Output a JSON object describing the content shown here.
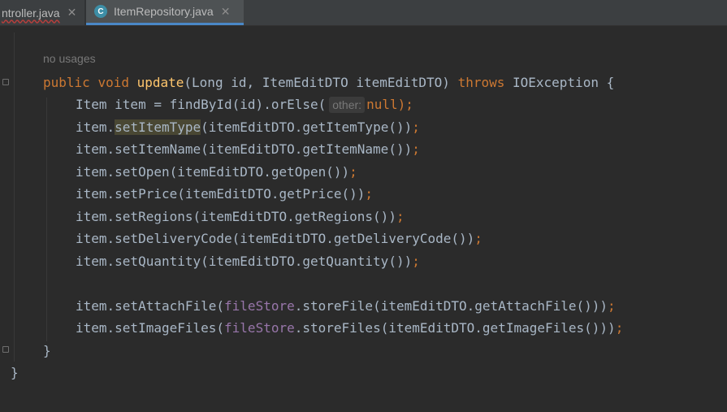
{
  "tabs": [
    {
      "label": "ntroller.java",
      "active": false,
      "has_error": true
    },
    {
      "label": "ItemRepository.java",
      "active": true,
      "icon": "class-icon",
      "icon_letter": "C"
    }
  ],
  "close_glyph": "✕",
  "usages_hint": "no usages",
  "param_hint": "other:",
  "code": {
    "line1": {
      "kw1": "public",
      "kw2": "void",
      "name": "update",
      "p1": "(Long id, ItemEditDTO itemEditDTO) ",
      "kw3": "throws",
      "p2": " IOException {"
    },
    "line2": {
      "a": "Item item = findById(id).orElse(",
      "null": "null",
      "b": ");"
    },
    "line3": {
      "a": "item.",
      "hl": "setItemType",
      "b": "(itemEditDTO.getItemType())",
      "semi": ";"
    },
    "line4": {
      "a": "item.setItemName(itemEditDTO.getItemName())",
      "semi": ";"
    },
    "line5": {
      "a": "item.setOpen(itemEditDTO.getOpen())",
      "semi": ";"
    },
    "line6": {
      "a": "item.setPrice(itemEditDTO.getPrice())",
      "semi": ";"
    },
    "line7": {
      "a": "item.setRegions(itemEditDTO.getRegions())",
      "semi": ";"
    },
    "line8": {
      "a": "item.setDeliveryCode(itemEditDTO.getDeliveryCode())",
      "semi": ";"
    },
    "line9": {
      "a": "item.setQuantity(itemEditDTO.getQuantity())",
      "semi": ";"
    },
    "line10": {
      "a": "item.setAttachFile(",
      "fld": "fileStore",
      "b": ".storeFile(itemEditDTO.getAttachFile()))",
      "semi": ";"
    },
    "line11": {
      "a": "item.setImageFiles(",
      "fld": "fileStore",
      "b": ".storeFiles(itemEditDTO.getImageFiles()))",
      "semi": ";"
    },
    "line12": "}",
    "line13": "}"
  },
  "colors": {
    "background": "#2b2b2b",
    "keyword": "#cc7832",
    "method_decl": "#ffc66d",
    "field": "#9876aa",
    "text": "#a9b7c6",
    "tab_accent": "#4a88c7"
  }
}
